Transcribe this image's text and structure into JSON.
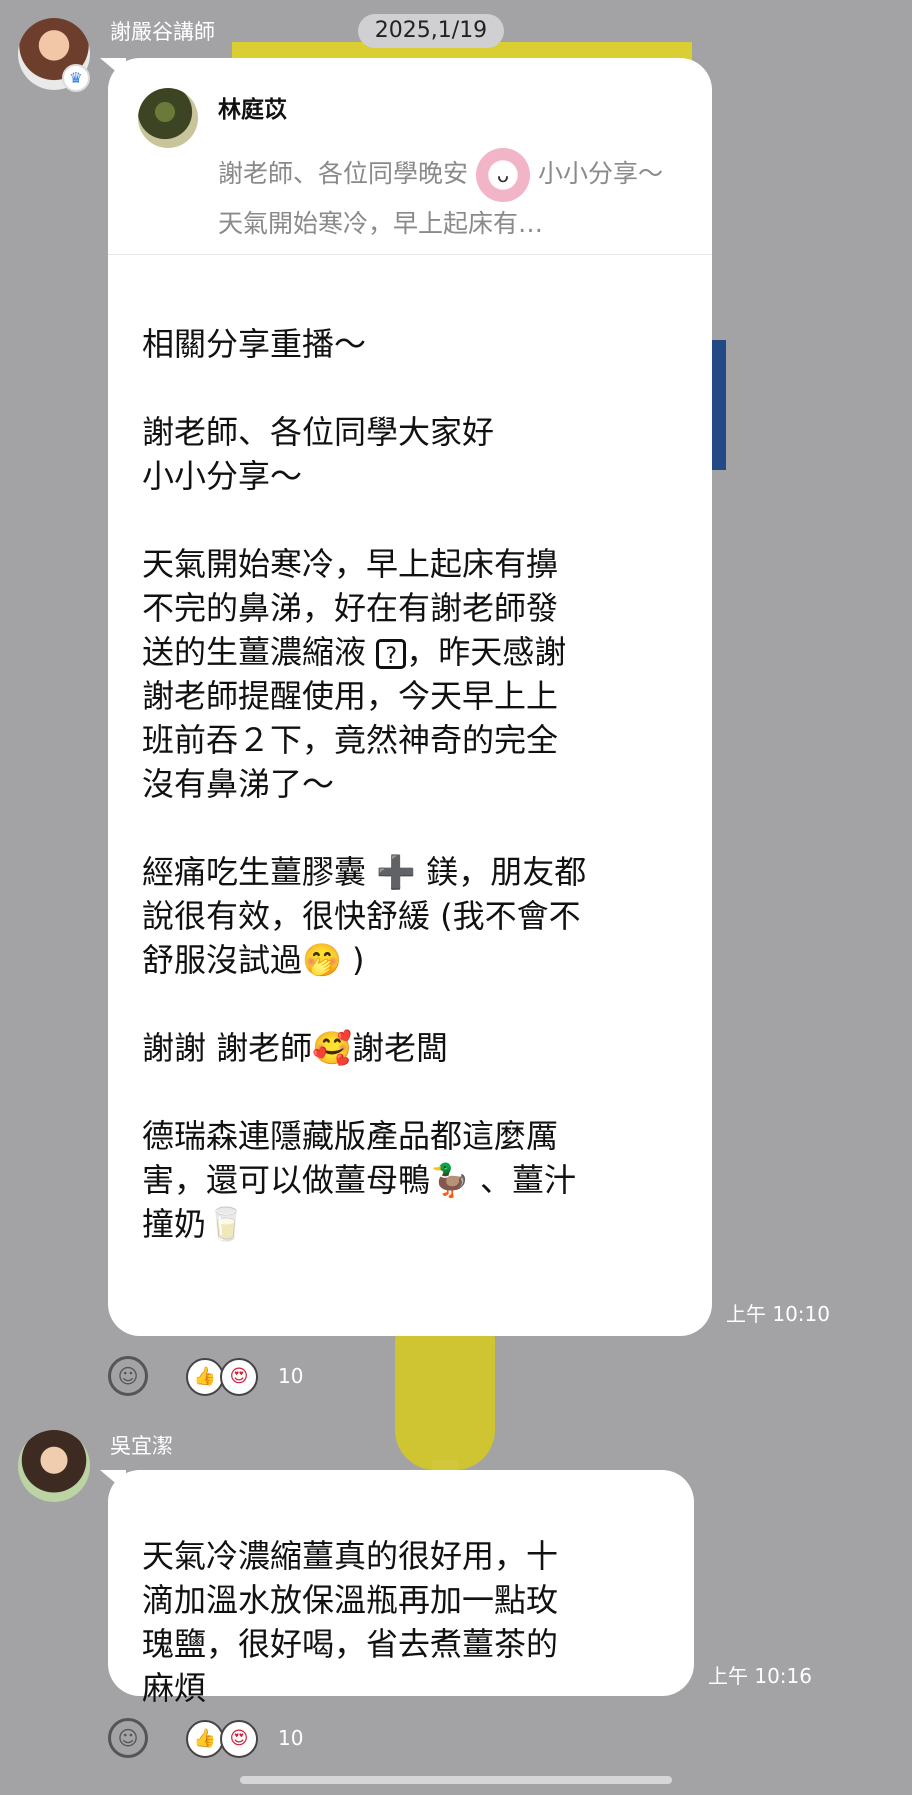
{
  "date_pill": "2025,1/19",
  "messages": [
    {
      "sender": "謝嚴谷講師",
      "badge_icon": "crown-icon",
      "reply": {
        "name": "林庭苡",
        "text_before": "謝老師、各位同學晚安",
        "text_after": "小小分享～ 天氣開始寒冷，早上起床有…"
      },
      "body": [
        "相關分享重播～",
        "",
        "謝老師、各位同學大家好",
        "小小分享～",
        "",
        "天氣開始寒冷，早上起床有擤",
        "不完的鼻涕，好在有謝老師發",
        "送的生薑濃縮液",
        "，昨天感謝",
        "謝老師提醒使用，今天早上上",
        "班前吞２下，竟然神奇的完全",
        "沒有鼻涕了～",
        "",
        "經痛吃生薑膠囊 ➕ 鎂，朋友都",
        "說很有效，很快舒緩 (我不會不",
        "舒服沒試過🤭 )",
        "",
        "謝謝 謝老師🥰謝老闆",
        "",
        "德瑞森連隱藏版產品都這麼厲",
        "害，還可以做薑母鴨🦆 、薑汁",
        "撞奶🥛"
      ],
      "time": "上午 10:10",
      "reaction_count": "10"
    },
    {
      "sender": "吳宜潔",
      "body": [
        "天氣冷濃縮薑真的很好用，十",
        "滴加溫水放保溫瓶再加一點玫",
        "瑰鹽，很好喝，省去煮薑茶的",
        "麻煩"
      ],
      "time": "上午 10:16",
      "reaction_count": "10"
    }
  ],
  "icons": {
    "question_box": "?",
    "add_reaction": "☺",
    "reaction_a": "👍",
    "reaction_b": "😍"
  }
}
